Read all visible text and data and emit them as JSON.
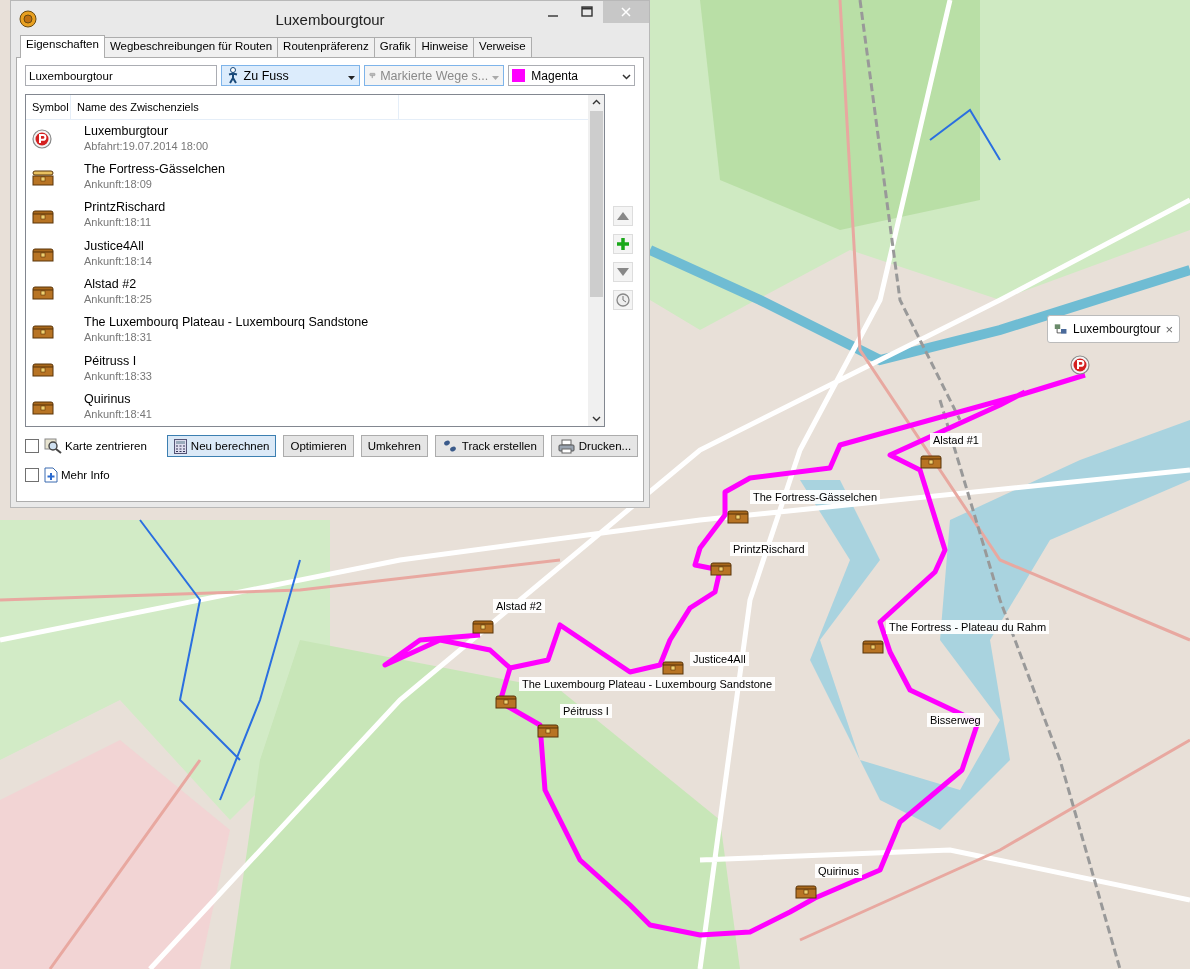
{
  "window": {
    "title": "Luxembourgtour"
  },
  "tabs": [
    {
      "label": "Eigenschaften",
      "selected": true
    },
    {
      "label": "Wegbeschreibungen für Routen",
      "selected": false
    },
    {
      "label": "Routenpräferenz",
      "selected": false
    },
    {
      "label": "Grafik",
      "selected": false
    },
    {
      "label": "Hinweise",
      "selected": false
    },
    {
      "label": "Verweise",
      "selected": false
    }
  ],
  "route_name": {
    "value": "Luxembourgtour"
  },
  "activity": {
    "value": "Zu Fuss",
    "disabled": false
  },
  "trail_option": {
    "value": "Markierte Wege s...",
    "disabled": true
  },
  "route_color": {
    "value": "Magenta",
    "color": "#ff00ff"
  },
  "table": {
    "columns": [
      "Symbol",
      "Name des Zwischenziels"
    ],
    "rows": [
      {
        "kind": "parking",
        "name": "Luxemburgtour",
        "detail": "Abfahrt:19.07.2014 18:00"
      },
      {
        "kind": "open-chest",
        "name": "The Fortress-Gässelchen",
        "detail": "Ankunft:18:09"
      },
      {
        "kind": "chest",
        "name": "PrintzRischard",
        "detail": "Ankunft:18:11"
      },
      {
        "kind": "chest",
        "name": "Justice4All",
        "detail": "Ankunft:18:14"
      },
      {
        "kind": "chest",
        "name": "Alstad #2",
        "detail": "Ankunft:18:25"
      },
      {
        "kind": "chest",
        "name": "The Luxembourq Plateau - Luxembourq Sandstone",
        "detail": "Ankunft:18:31"
      },
      {
        "kind": "chest",
        "name": "Péitruss I",
        "detail": "Ankunft:18:33"
      },
      {
        "kind": "chest",
        "name": "Quirinus",
        "detail": "Ankunft:18:41"
      }
    ]
  },
  "options": [
    {
      "label": "Karte zentrieren",
      "checked": false,
      "kind": "center"
    },
    {
      "label": "Mehr Info",
      "checked": false,
      "kind": "info"
    }
  ],
  "buttons": [
    {
      "label": "Neu berechnen",
      "kind": "calc"
    },
    {
      "label": "Optimieren",
      "kind": "plain"
    },
    {
      "label": "Umkehren",
      "kind": "plain"
    },
    {
      "label": "Track erstellen",
      "kind": "track"
    },
    {
      "label": "Drucken...",
      "kind": "print"
    }
  ],
  "map": {
    "popup": {
      "title": "Luxembourgtour",
      "close": "×"
    },
    "labels": [
      {
        "text": "Alstad #1",
        "kind": "chest"
      },
      {
        "text": "The Fortress-Gässelchen",
        "kind": "chest"
      },
      {
        "text": "PrintzRischard",
        "kind": "chest"
      },
      {
        "text": "Alstad #2",
        "kind": "chest"
      },
      {
        "text": "Justice4All",
        "kind": "chest"
      },
      {
        "text": "The Luxembourg Plateau - Luxembourg Sandstone",
        "kind": "chest"
      },
      {
        "text": "Péitruss I",
        "kind": "chest"
      },
      {
        "text": "The Fortress - Plateau du Rahm",
        "kind": "chest"
      },
      {
        "text": "Bisserweg",
        "kind": "plain"
      },
      {
        "text": "Quirinus",
        "kind": "chest"
      }
    ]
  }
}
